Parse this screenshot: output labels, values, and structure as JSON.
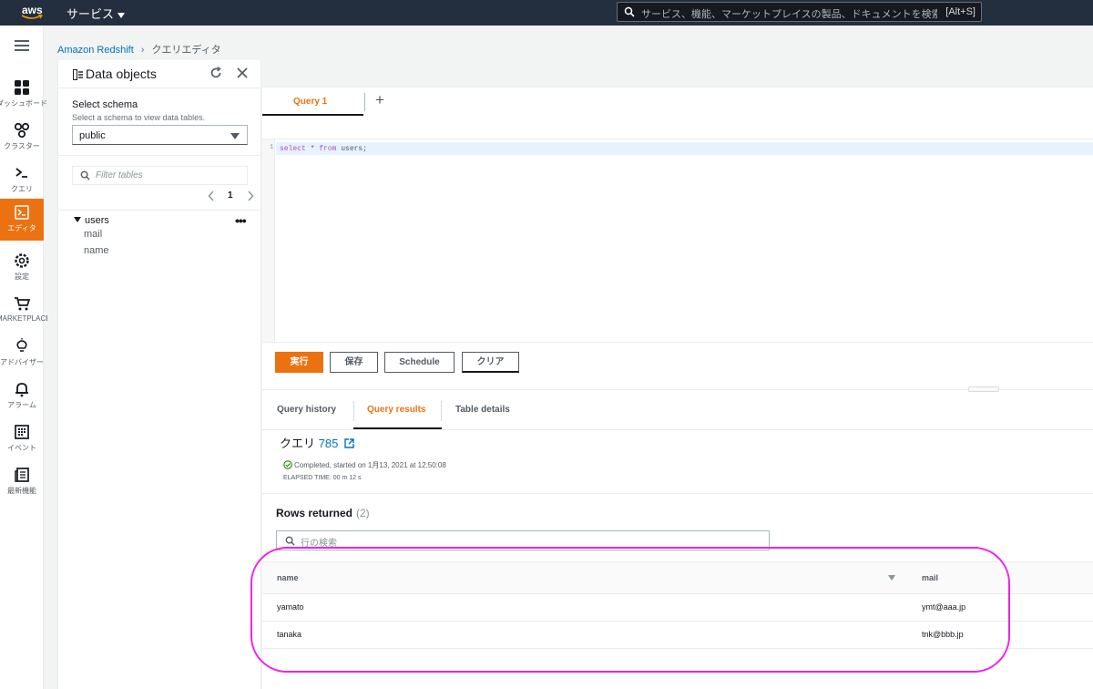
{
  "topbar": {
    "logo_text": "aws",
    "services_label": "サービス",
    "search_placeholder": "サービス、機能、マーケットプレイスの製品、ドキュメントを検索",
    "search_shortcut": "[Alt+S]"
  },
  "leftnav": {
    "items": [
      {
        "label": "ダッシュボード",
        "icon": "dashboard-icon"
      },
      {
        "label": "クラスター",
        "icon": "cluster-icon"
      },
      {
        "label": "クエリ",
        "icon": "query-icon"
      },
      {
        "label": "エディタ",
        "icon": "editor-icon",
        "active": true
      },
      {
        "label": "設定",
        "icon": "settings-icon"
      },
      {
        "label": "MARKETPLACE",
        "icon": "marketplace-icon"
      },
      {
        "label": "アドバイザー",
        "icon": "advisor-icon"
      },
      {
        "label": "アラーム",
        "icon": "alarm-icon"
      },
      {
        "label": "イベント",
        "icon": "events-icon"
      },
      {
        "label": "最新機能",
        "icon": "whats-new-icon"
      }
    ]
  },
  "breadcrumb": {
    "root": "Amazon Redshift",
    "current": "クエリエディタ"
  },
  "data_objects": {
    "title": "Data objects",
    "schema_label": "Select schema",
    "schema_desc": "Select a schema to view data tables.",
    "schema_value": "public",
    "filter_placeholder": "Filter tables",
    "page": "1",
    "table_name": "users",
    "columns": [
      "mail",
      "name"
    ]
  },
  "editor": {
    "tab_label": "Query 1",
    "line_number": "1",
    "sql_kw1": "select",
    "sql_mid": " * ",
    "sql_kw2": "from",
    "sql_end": " users;"
  },
  "buttons": {
    "run": "実行",
    "save": "保存",
    "schedule": "Schedule",
    "clear": "クリア"
  },
  "result_tabs": {
    "history": "Query history",
    "results": "Query results",
    "details": "Table details"
  },
  "query_info": {
    "label": "クエリ",
    "id": "785",
    "status": "Completed, started on 1月13, 2021 at 12:50:08",
    "elapsed": "ELAPSED TIME: 00 m 12 s"
  },
  "results": {
    "title": "Rows returned",
    "count": "(2)",
    "search_placeholder": "行の検索",
    "headers": [
      "name",
      "mail"
    ],
    "rows": [
      [
        "yamato",
        "ymt@aaa.jp"
      ],
      [
        "tanaka",
        "tnk@bbb.jp"
      ]
    ]
  },
  "colors": {
    "accent": "#ec7211",
    "link": "#0073bb",
    "topbar": "#232f3e",
    "annotation": "#ee22ee",
    "success": "#1d8102"
  }
}
